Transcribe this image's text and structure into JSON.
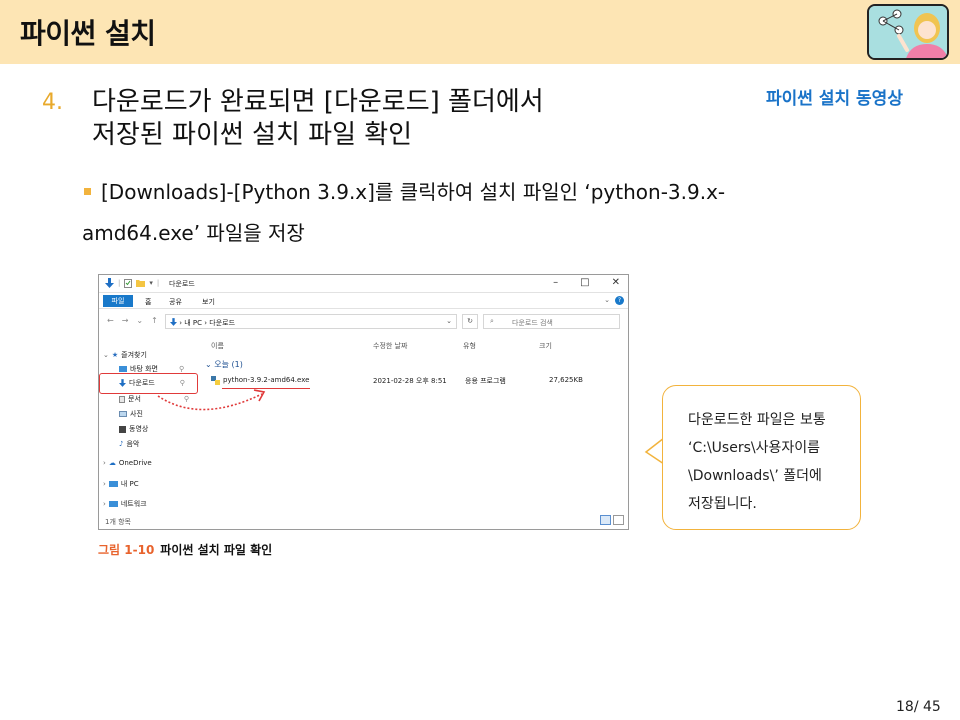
{
  "header": {
    "title": "파이썬 설치"
  },
  "video_link": "파이썬 설치 동영상",
  "step": {
    "number": "4.",
    "line1": "다운로드가 완료되면 [다운로드] 폴더에서",
    "line2": "저장된 파이썬 설치 파일 확인"
  },
  "bullet": {
    "line1": "[Downloads]-[Python 3.9.x]를 클릭하여 설치 파일인 ‘python-3.9.x-",
    "line2": "amd64.exe’ 파일을 저장"
  },
  "explorer": {
    "title": "다운로드",
    "ribbon_tabs": [
      "파일",
      "홈",
      "공유",
      "보기"
    ],
    "address": "› 내 PC › 다운로드",
    "search_placeholder": "다운로드 검색",
    "columns": [
      "이름",
      "수정한 날짜",
      "유형",
      "크기"
    ],
    "group": "오늘 (1)",
    "sidebar": {
      "quick_access": "즐겨찾기",
      "items": [
        "바탕 화면",
        "다운로드",
        "문서",
        "사진",
        "동영상",
        "음악"
      ],
      "onedrive": "OneDrive",
      "this_pc": "내 PC",
      "network": "네트워크"
    },
    "file": {
      "name": "python-3.9.2-amd64.exe",
      "date": "2021-02-28 오후 8:51",
      "type": "응용 프로그램",
      "size": "27,625KB"
    },
    "status": "1개 항목"
  },
  "caption": {
    "label": "그림 1-10",
    "text": "파이썬 설치 파일 확인"
  },
  "bubble": {
    "lines": [
      "다운로드한 파일은 보통",
      "‘C:\\Users\\사용자이름",
      "\\Downloads\\’ 폴더에",
      "저장됩니다."
    ]
  },
  "page_number": "18/ 45",
  "colors": {
    "header_bg": "#fde5b4",
    "accent_orange": "#e8a92b",
    "link_blue": "#1a73c8",
    "highlight_red": "#e03a3a"
  }
}
